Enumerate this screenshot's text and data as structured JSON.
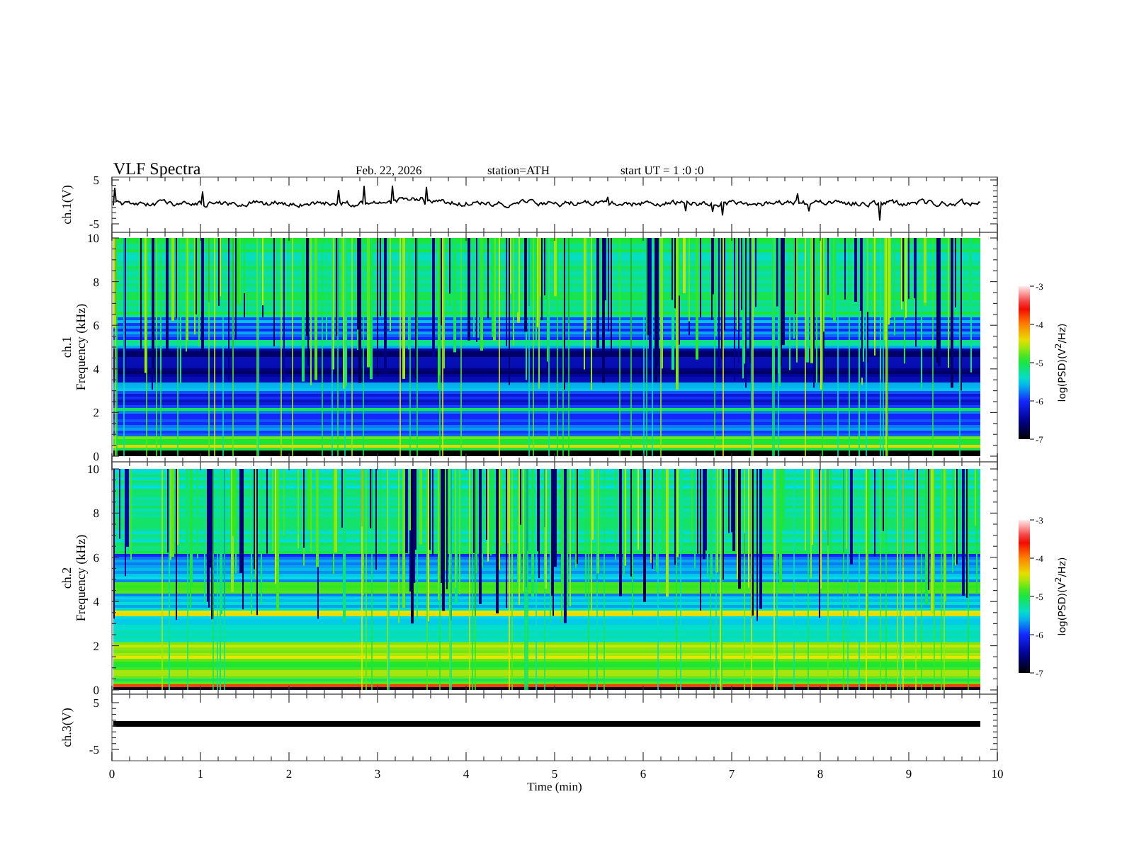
{
  "header": {
    "title": "VLF Spectra",
    "date": "Feb. 22, 2026",
    "station": "station=ATH",
    "start": "start UT =  1 :0 :0"
  },
  "panels": [
    {
      "kind": "waveform",
      "ylabel": [
        "ch.1(V)"
      ],
      "yticks": [
        "5",
        "-5"
      ]
    },
    {
      "kind": "spectrogram",
      "ylabel": [
        "ch.1",
        "Frequency (kHz)"
      ],
      "yticks": [
        "10",
        "8",
        "6",
        "4",
        "2",
        "0"
      ],
      "colorbar": {
        "label": "log(PSD)(V$^{2}$/Hz)",
        "ticks": [
          "-3",
          "-4",
          "-5",
          "-6",
          "-7"
        ]
      }
    },
    {
      "kind": "spectrogram",
      "ylabel": [
        "ch.2",
        "Frequency (kHz)"
      ],
      "yticks": [
        "10",
        "8",
        "6",
        "4",
        "2",
        "0"
      ],
      "colorbar": {
        "label": "log(PSD)(V$^{2}$/Hz)",
        "ticks": [
          "-3",
          "-4",
          "-5",
          "-6",
          "-7"
        ]
      }
    },
    {
      "kind": "flatline",
      "ylabel": [
        "ch.3(V)"
      ],
      "yticks": [
        "5",
        "-5"
      ]
    }
  ],
  "x_axis": {
    "ticks": [
      "0",
      "1",
      "2",
      "3",
      "4",
      "5",
      "6",
      "7",
      "8",
      "9",
      "10"
    ],
    "label": "Time (min)"
  }
}
